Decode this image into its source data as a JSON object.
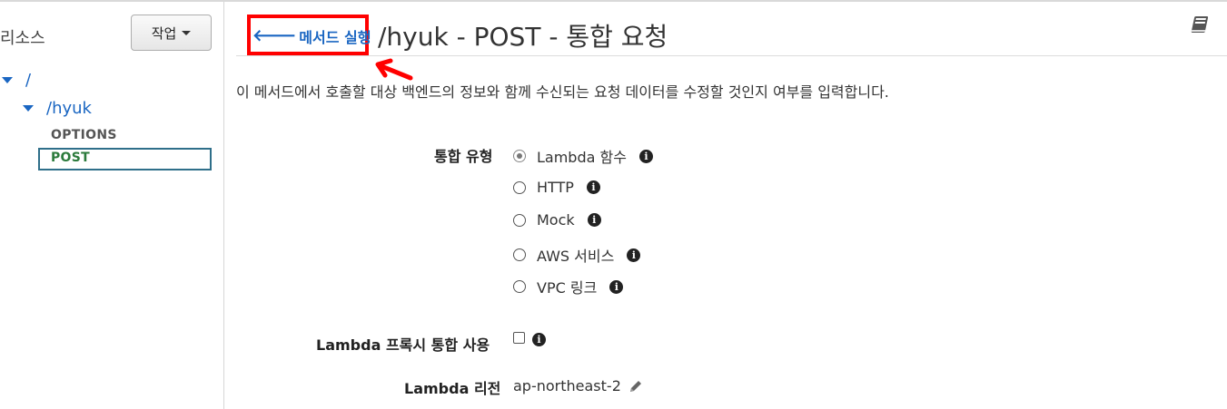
{
  "sidebar": {
    "title": "리소스",
    "action_button": "작업",
    "tree": {
      "root": "/",
      "child": "/hyuk",
      "methods": [
        "OPTIONS",
        "POST"
      ]
    }
  },
  "header": {
    "back_link": "메서드 실행",
    "back_arrow": "🡐",
    "title": "/hyuk - POST - 통합 요청"
  },
  "description": "이 메서드에서 호출할 대상 백엔드의 정보와 함께 수신되는 요청 데이터를 수정할 것인지 여부를 입력합니다.",
  "form": {
    "integration_type_label": "통합 유형",
    "integration_types": [
      {
        "label": "Lambda 함수",
        "selected": true
      },
      {
        "label": "HTTP",
        "selected": false
      },
      {
        "label": "Mock",
        "selected": false
      },
      {
        "label": "AWS 서비스",
        "selected": false
      },
      {
        "label": "VPC 링크",
        "selected": false
      }
    ],
    "proxy_label": "Lambda 프록시 통합 사용",
    "proxy_checked": false,
    "region_label": "Lambda 리전",
    "region_value": "ap-northeast-2",
    "info_glyph": "i"
  },
  "colors": {
    "link": "#1a66c2",
    "highlight_box": "#ff0000",
    "post_method": "#2b7a3b"
  }
}
